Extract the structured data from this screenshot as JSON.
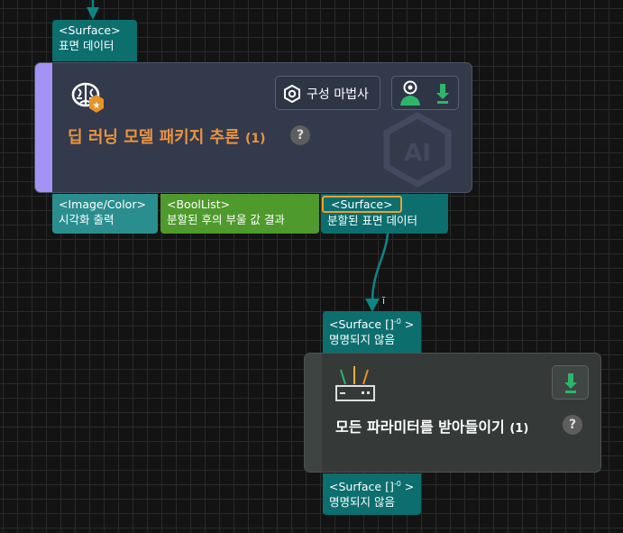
{
  "colors": {
    "canvas": "#131313",
    "deep_node_bg": "#323a4c",
    "deep_node_accent": "#a493f5",
    "bottom_node_bg": "#353a38",
    "title_orange": "#ec9342",
    "port_teal": "#0d6e6e",
    "port_green": "#4e9a2c",
    "port_selected_border": "#e8a030",
    "connection": "#0e8585"
  },
  "top_port": {
    "type": "<Surface>",
    "label": "표면 데이터"
  },
  "deep_learning_node": {
    "title": "딥 러닝 모델 패키지 추론",
    "count": "(1)",
    "help": "?",
    "wizard_button": "구성 마법사",
    "icons": [
      "brain-icon",
      "settings-hexagon-icon",
      "eye-user-icon",
      "download-arrow-icon",
      "ai-watermark-icon"
    ],
    "watermark": "AI",
    "outputs": [
      {
        "type": "<Image/Color>",
        "label": "시각화 출력"
      },
      {
        "type": "<BoolList>",
        "label": "분할된 후의 부울 값 결과"
      },
      {
        "type": "<Surface>",
        "label": "분할된 표면 데이터"
      }
    ]
  },
  "receive_node": {
    "title": "모든 파라미터를 받아들이기",
    "count": "(1)",
    "help": "?",
    "input_port": {
      "type": "<Surface []",
      "sup": "-0",
      "suffix": " >",
      "label": "명명되지 않음"
    },
    "output_port": {
      "type": "<Surface []",
      "sup": "-0",
      "suffix": " >",
      "label": "명명되지 않음"
    },
    "icons": [
      "router-icon",
      "download-arrow-icon"
    ]
  },
  "connection_marker": "ī"
}
